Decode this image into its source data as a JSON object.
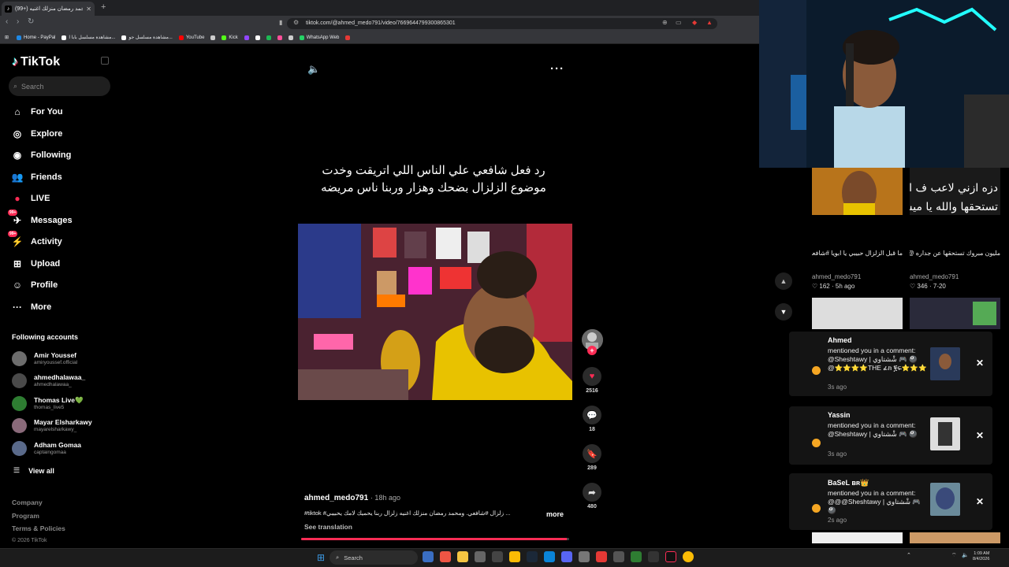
{
  "browser": {
    "tab_title": "(99+) محمد رمضان منزلك اغنيه",
    "tab_icon": "tiktok-icon",
    "url": "tiktok.com/@ahmed_medo791/video/7669644799300865301",
    "bookmarks": [
      {
        "label": "Home - PayPal",
        "color": "#1e88e5"
      },
      {
        "label": "مشاهدة مسلسل بابا ا...",
        "color": "#ffffff"
      },
      {
        "label": "مشاهدة مسلسل جو...",
        "color": "#ffffff"
      },
      {
        "label": "YouTube",
        "color": "#ff0000"
      },
      {
        "label": "",
        "color": "#cccccc"
      },
      {
        "label": "Kick",
        "color": "#53fc18"
      },
      {
        "label": "",
        "color": "#9146ff"
      },
      {
        "label": "",
        "color": "#ffffff"
      },
      {
        "label": "",
        "color": "#1db954"
      },
      {
        "label": "",
        "color": "#ff4f9a"
      },
      {
        "label": "",
        "color": "#cccccc"
      },
      {
        "label": "WhatsApp Web",
        "color": "#25d366"
      },
      {
        "label": "",
        "color": "#e53935"
      }
    ]
  },
  "sidebar": {
    "logo": "TikTok",
    "search_placeholder": "Search",
    "nav": [
      {
        "label": "For You",
        "icon": "home-icon"
      },
      {
        "label": "Explore",
        "icon": "compass-icon"
      },
      {
        "label": "Following",
        "icon": "following-icon"
      },
      {
        "label": "Friends",
        "icon": "friends-icon"
      },
      {
        "label": "LIVE",
        "icon": "live-icon"
      },
      {
        "label": "Messages",
        "icon": "messages-icon",
        "badge": "99+"
      },
      {
        "label": "Activity",
        "icon": "activity-icon",
        "badge": "99+"
      },
      {
        "label": "Upload",
        "icon": "upload-icon"
      },
      {
        "label": "Profile",
        "icon": "profile-icon"
      },
      {
        "label": "More",
        "icon": "more-icon"
      }
    ],
    "following_title": "Following accounts",
    "accounts": [
      {
        "name": "Amir Youssef",
        "handle": "amiryoussef.official"
      },
      {
        "name": "ahmedhalawaa_",
        "handle": "ahmedhalawaa_"
      },
      {
        "name": "Thomas Live💚",
        "handle": "thomas_live5"
      },
      {
        "name": "Mayar Elsharkawy",
        "handle": "mayarelsharkawy_"
      },
      {
        "name": "Adham Gomaa",
        "handle": "captaingomaa"
      }
    ],
    "view_all": "View all",
    "footer": [
      "Company",
      "Program",
      "Terms & Policies"
    ],
    "copyright": "© 2026 TikTok"
  },
  "video": {
    "caption_text": "رد فعل شافعي علي الناس اللي اتريقت وخدت موضوع الزلزال بضحك وهزار وربنا ناس مريضه",
    "author": "ahmed_medo791",
    "time_ago": "· 18h ago",
    "description": "#tiktok #زلزال #شافعي. ومحمد رمضان منزلك اغنيه زلزال ربنا يحميك لامك يحبيبي ...",
    "more_label": "more",
    "see_translation": "See translation",
    "progress": 0.99,
    "likes": "2516",
    "comments": "18",
    "saves": "289",
    "shares": "480"
  },
  "feed": [
    {
      "title": "ما قبل الزلزال حبيبي يا ابويا #شافعي #explore #fory...",
      "author": "ahmed_medo791",
      "stats": "162 · 5h ago"
    },
    {
      "title": "مليون مبروك تستحقها عن جداره @messi...",
      "author": "ahmed_medo791",
      "stats": "346 · 7-20"
    }
  ],
  "notifications": [
    {
      "name": "Ahmed",
      "message": "mentioned you in a comment: @Sheshtawy | شْشتاوي 🎮 🎱 @⭐⭐⭐⭐THE ፊክ ፪ፍ⭐⭐⭐",
      "time": "3s ago"
    },
    {
      "name": "Yassin",
      "message": "mentioned you in a comment: @Sheshtawy | شْشتاوي 🎮 🎱",
      "time": "3s ago"
    },
    {
      "name": "BaSeL ʙʀ👑",
      "message": "mentioned you in a comment: @@@Sheshtawy | شْشتاوي 🎮 🎱",
      "time": "2s ago"
    }
  ],
  "taskbar": {
    "search": "Search",
    "time": "1:09 AM",
    "date": "8/4/2026"
  }
}
